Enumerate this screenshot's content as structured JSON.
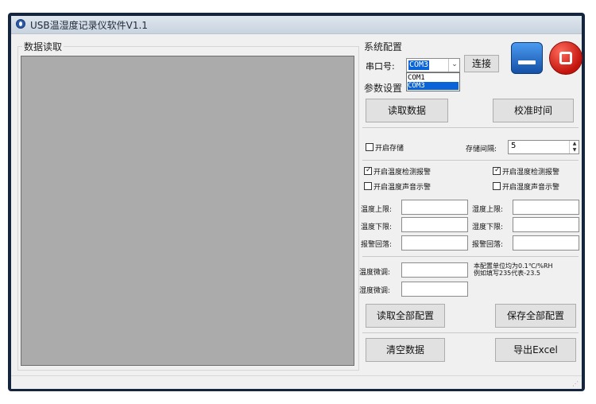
{
  "window": {
    "title": "USB温湿度记录仪软件V1.1"
  },
  "data_panel": {
    "title": "数据读取"
  },
  "system_config": {
    "title": "系统配置",
    "port_label": "串口号:",
    "port_value": "COM3",
    "port_options": [
      "COM1",
      "COM3"
    ],
    "connect_label": "连接"
  },
  "params": {
    "title": "参数设置",
    "read_data_label": "读取数据",
    "calibrate_time_label": "校准时间",
    "enable_storage_label": "开启存储",
    "enable_storage_checked": false,
    "interval_label": "存储间隔:",
    "interval_value": "5",
    "temp_alarm_label": "开启温度检测报警",
    "temp_alarm_checked": true,
    "hum_alarm_label": "开启湿度检测报警",
    "hum_alarm_checked": true,
    "temp_sound_label": "开启温度声音示警",
    "temp_sound_checked": false,
    "hum_sound_label": "开启湿度声音示警",
    "hum_sound_checked": false,
    "temp_upper_label": "温度上限:",
    "temp_lower_label": "温度下限:",
    "alarm_hyst_label_left": "报警回落:",
    "hum_upper_label": "湿度上限:",
    "hum_lower_label": "湿度下限:",
    "alarm_hyst_label_right": "报警回落:",
    "temp_adjust_label": "温度微调:",
    "hum_adjust_label": "湿度微调:",
    "note_line1": "本配置单位均为0.1℃/%RH",
    "note_line2": "例如填写235代表-23.5",
    "read_all_label": "读取全部配置",
    "save_all_label": "保存全部配置",
    "clear_label": "清空数据",
    "export_label": "导出Excel"
  },
  "icons": {
    "minimize": "minimize-icon",
    "close": "close-icon",
    "app": "app-icon"
  },
  "colors": {
    "data_area": "#ababab",
    "minimize_blue": "#1f68c4",
    "close_red": "#d9251d"
  }
}
